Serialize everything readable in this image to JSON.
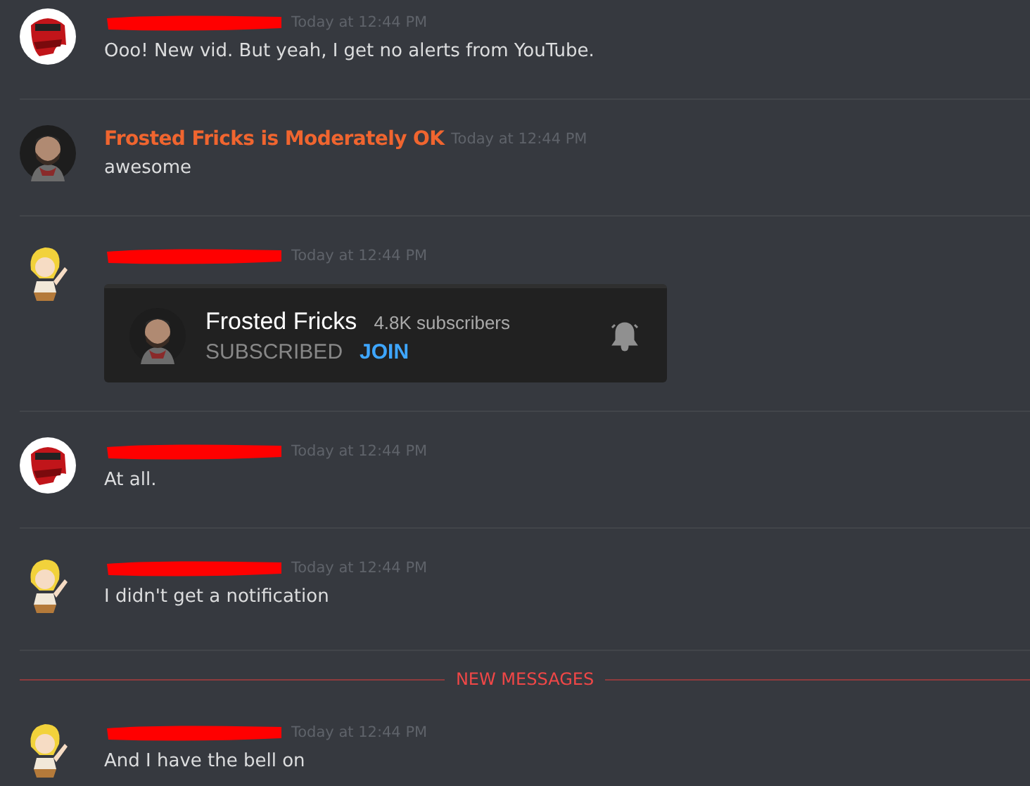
{
  "feed": [
    {
      "kind": "message",
      "avatar": {
        "kind": "red"
      },
      "author": {
        "redacted": true
      },
      "time": "Today at 12:44 PM",
      "text": "Ooo! New vid. But yeah, I get no alerts from YouTube."
    },
    {
      "kind": "message",
      "avatar": {
        "kind": "dark"
      },
      "author": {
        "redacted": false,
        "name": "Frosted Fricks is Moderately OK",
        "color": "#f0652f"
      },
      "time": "Today at 12:44 PM",
      "text": "awesome"
    },
    {
      "kind": "message",
      "avatar": {
        "kind": "blonde"
      },
      "author": {
        "redacted": true
      },
      "time": "Today at 12:44 PM",
      "embed": {
        "channel": "Frosted Fricks",
        "subscribers": "4.8K subscribers",
        "subscribed": "SUBSCRIBED",
        "join": "JOIN"
      }
    },
    {
      "kind": "message",
      "avatar": {
        "kind": "red"
      },
      "author": {
        "redacted": true
      },
      "time": "Today at 12:44 PM",
      "text": "At all."
    },
    {
      "kind": "message",
      "avatar": {
        "kind": "blonde"
      },
      "author": {
        "redacted": true
      },
      "time": "Today at 12:44 PM",
      "text": "I didn't get a notification"
    },
    {
      "kind": "divider",
      "label": "NEW MESSAGES"
    },
    {
      "kind": "message",
      "avatar": {
        "kind": "blonde"
      },
      "author": {
        "redacted": true
      },
      "time": "Today at 12:44 PM",
      "text": "And I have the bell on"
    }
  ]
}
